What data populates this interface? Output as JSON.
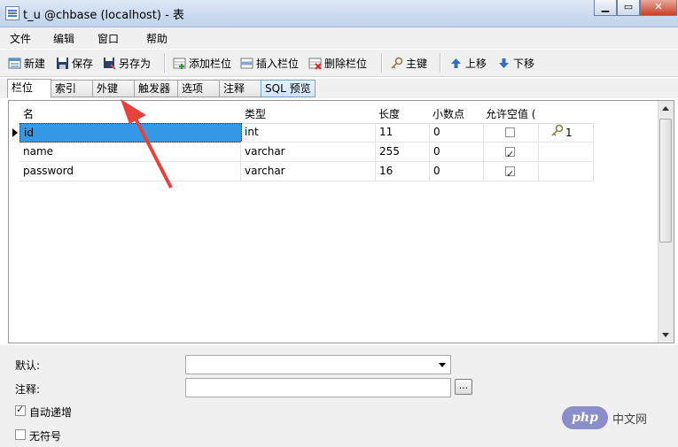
{
  "window": {
    "title": "t_u @chbase (localhost) - 表"
  },
  "menu": [
    "文件",
    "编辑",
    "窗口",
    "帮助"
  ],
  "toolbar": {
    "new": "新建",
    "save": "保存",
    "save_as": "另存为",
    "add_column": "添加栏位",
    "insert_column": "插入栏位",
    "delete_column": "删除栏位",
    "primary_key": "主键",
    "move_up": "上移",
    "move_down": "下移"
  },
  "tabs": [
    "栏位",
    "索引",
    "外键",
    "触发器",
    "选项",
    "注释",
    "SQL 预览"
  ],
  "grid": {
    "headers": {
      "name": "名",
      "type": "类型",
      "length": "长度",
      "decimals": "小数点",
      "nullable": "允许空值 ("
    },
    "rows": [
      {
        "name": "id",
        "type": "int",
        "length": "11",
        "decimals": "0",
        "nullable": false,
        "key": "1"
      },
      {
        "name": "name",
        "type": "varchar",
        "length": "255",
        "decimals": "0",
        "nullable": true,
        "key": ""
      },
      {
        "name": "password",
        "type": "varchar",
        "length": "16",
        "decimals": "0",
        "nullable": true,
        "key": ""
      }
    ]
  },
  "props": {
    "default_label": "默认:",
    "comment_label": "注释:",
    "browse_button": "...",
    "auto_increment_label": "自动递增",
    "auto_increment_checked": true,
    "unsigned_label": "无符号",
    "unsigned_checked": false
  },
  "watermark": {
    "logo": "php",
    "text": "中文网"
  },
  "colors": {
    "selection": "#3398e5",
    "annotation_arrow": "#e8413c"
  }
}
